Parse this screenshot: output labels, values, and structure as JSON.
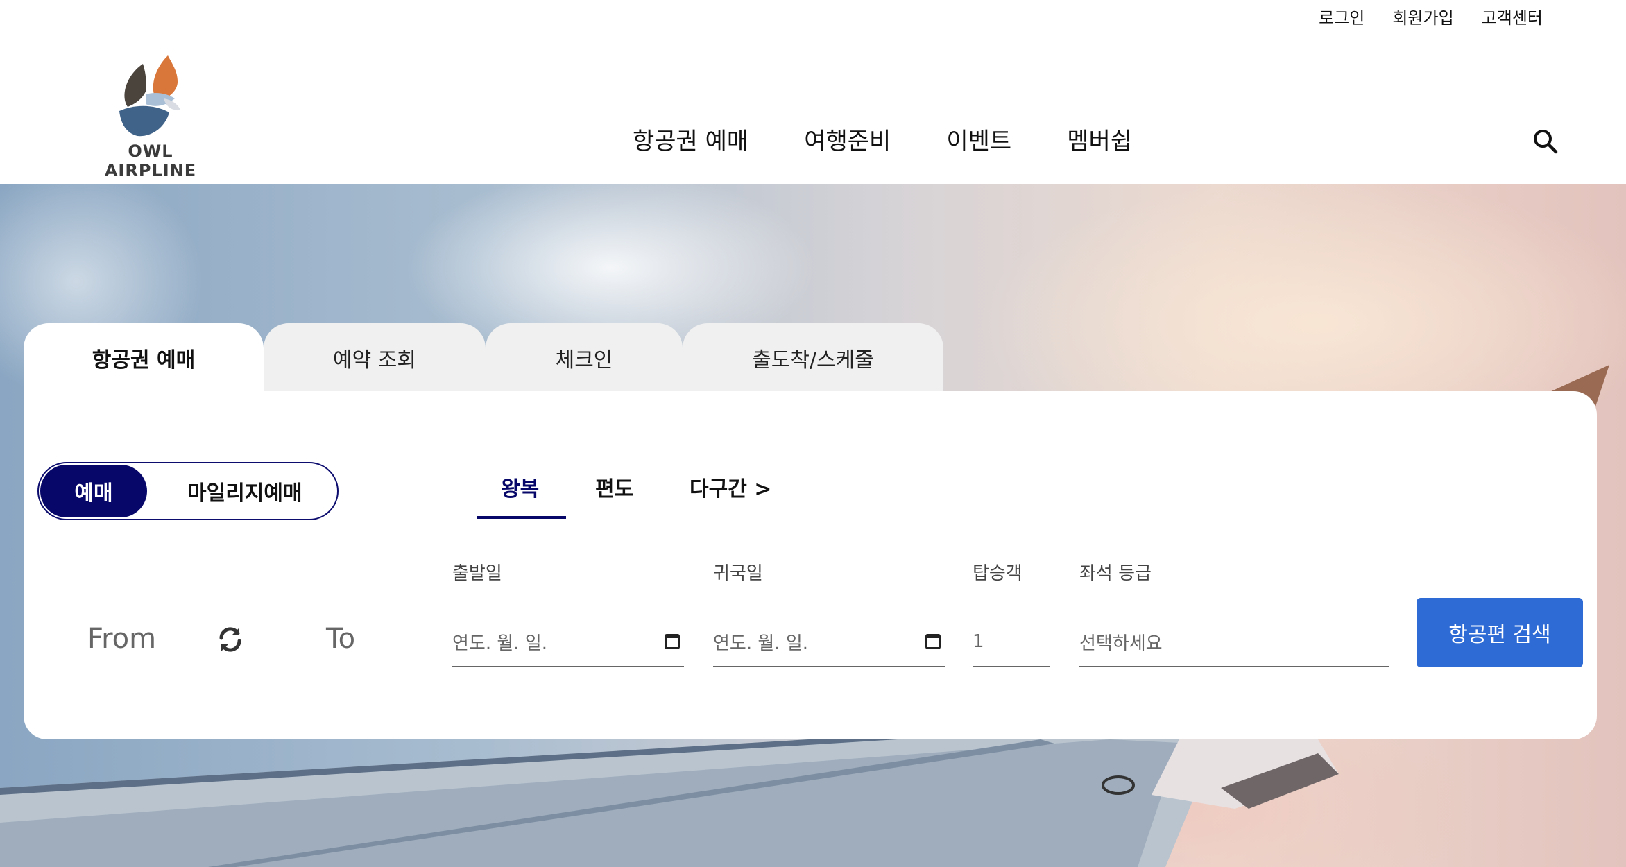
{
  "util_links": [
    "로그인",
    "회원가입",
    "고객센터"
  ],
  "logo": {
    "text": "OWL AIRPLINE"
  },
  "nav": [
    "항공권 예매",
    "여행준비",
    "이벤트",
    "멤버쉽"
  ],
  "tabs": [
    "항공권 예매",
    "예약 조회",
    "체크인",
    "출도착/스케줄"
  ],
  "booking_type": {
    "selected": "예매",
    "other": "마일리지예매"
  },
  "trip_types": [
    "왕복",
    "편도",
    "다구간 >"
  ],
  "route": {
    "from": "From",
    "to": "To"
  },
  "fields": {
    "depart": {
      "label": "출발일",
      "placeholder": "연도. 월. 일."
    },
    "return": {
      "label": "귀국일",
      "placeholder": "연도. 월. 일."
    },
    "passengers": {
      "label": "탑승객",
      "value": "1"
    },
    "seat_class": {
      "label": "좌석 등급",
      "placeholder": "선택하세요"
    }
  },
  "search_button": "항공편 검색",
  "colors": {
    "navy": "#07076a",
    "primary_blue": "#2e6bd4",
    "logo_orange": "#d9763a",
    "logo_blue": "#3f6389"
  }
}
